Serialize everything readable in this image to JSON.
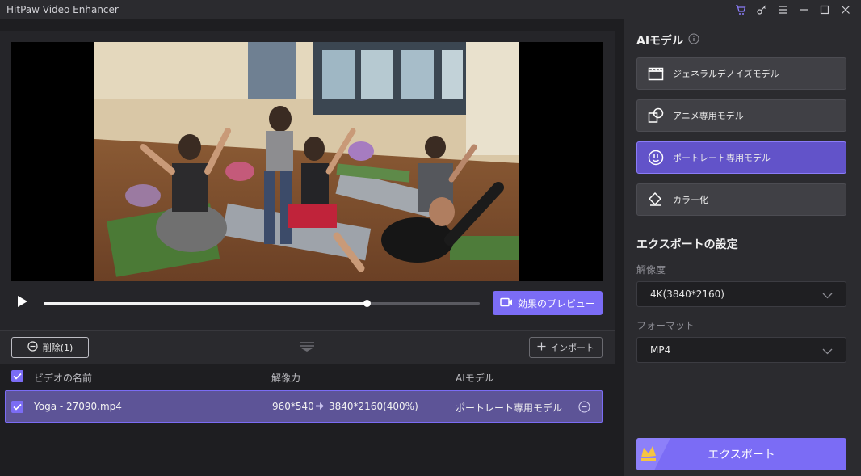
{
  "app": {
    "title": "HitPaw Video Enhancer"
  },
  "player": {
    "preview_label": "効果のプレビュー",
    "progress": 0.74
  },
  "file_bar": {
    "delete_label": "削除(1)",
    "import_label": "インポート"
  },
  "table": {
    "headers": {
      "name": "ビデオの名前",
      "resolution": "解像力",
      "model": "AIモデル"
    },
    "rows": [
      {
        "name": "Yoga - 27090.mp4",
        "from": "960*540",
        "to": "3840*2160(400%)",
        "model": "ポートレート専用モデル"
      }
    ]
  },
  "ai_panel": {
    "title": "AIモデル",
    "models": [
      {
        "label": "ジェネラルデノイズモデル",
        "icon": "clapperboard-icon"
      },
      {
        "label": "アニメ専用モデル",
        "icon": "anime-shapes-icon"
      },
      {
        "label": "ポートレート専用モデル",
        "icon": "portrait-face-icon",
        "active": true
      },
      {
        "label": "カラー化",
        "icon": "paint-bucket-icon"
      }
    ]
  },
  "export_settings": {
    "title": "エクスポートの設定",
    "resolution_label": "解像度",
    "resolution_value": "4K(3840*2160)",
    "format_label": "フォーマット",
    "format_value": "MP4",
    "export_label": "エクスポート"
  },
  "colors": {
    "accent": "#7b6cf5",
    "active_row": "#5d5497",
    "panel": "#2b2b2f"
  }
}
